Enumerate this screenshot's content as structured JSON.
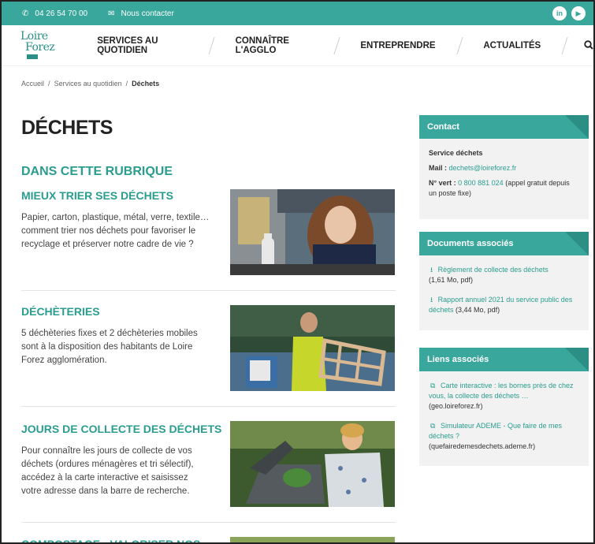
{
  "topbar": {
    "phone": "04 26 54 70 00",
    "contact": "Nous contacter",
    "phone_icon": "phone-icon",
    "contact_icon": "mail-icon",
    "social": [
      "linkedin-icon",
      "youtube-icon"
    ],
    "social_labels": [
      "in",
      "▶"
    ]
  },
  "nav": {
    "logo_line1": "Loire",
    "logo_line2": "Forez",
    "items": [
      "SERVICES AU QUOTIDIEN",
      "CONNAÎTRE L'AGGLO",
      "ENTREPRENDRE",
      "ACTUALITÉS"
    ],
    "search_icon": "🔍"
  },
  "breadcrumb": {
    "home": "Accueil",
    "sep": "/",
    "parent": "Services au quotidien",
    "current": "Déchets"
  },
  "page": {
    "title": "DÉCHETS",
    "rubrique": "DANS CETTE RUBRIQUE"
  },
  "entries": [
    {
      "title": "MIEUX TRIER SES DÉCHETS",
      "desc": "Papier, carton, plastique, métal, verre, textile… comment trier nos déchets pour favoriser le recyclage et préserver notre cadre de vie ?"
    },
    {
      "title": "DÉCHÈTERIES",
      "desc": "5 déchèteries fixes et 2 déchèteries mobiles sont à la disposition des habitants de Loire Forez agglomération."
    },
    {
      "title": "JOURS DE COLLECTE DES DÉCHETS",
      "desc": "Pour connaître les jours de collecte de vos déchets (ordures ménagères et tri sélectif), accédez à la carte interactive et saisissez votre adresse dans la barre de recherche."
    },
    {
      "title": "COMPOSTAGE : VALORISER NOS",
      "desc": ""
    }
  ],
  "sidebar": {
    "contact": {
      "title": "Contact",
      "service": "Service déchets",
      "mail_label": "Mail :",
      "mail": "dechets@loireforez.fr",
      "vert_label": "N° vert :",
      "vert": "0 800 881 024",
      "vert_note": "(appel gratuit depuis un poste fixe)"
    },
    "documents": {
      "title": "Documents associés",
      "items": [
        {
          "label": "Règlement de collecte des déchets",
          "meta": "(1,61 Mo, pdf)"
        },
        {
          "label": "Rapport annuel 2021 du service public des déchets",
          "meta": "(3,44 Mo, pdf)"
        }
      ]
    },
    "links": {
      "title": "Liens associés",
      "items": [
        {
          "label": "Carte interactive : les bornes près de chez vous, la collecte des déchets …",
          "meta": "(geo.loireforez.fr)"
        },
        {
          "label": "Simulateur ADEME - Que faire de mes déchets ?",
          "meta": "(quefairedemesdechets.ademe.fr)"
        }
      ]
    }
  },
  "colors": {
    "accent": "#3aa79c",
    "heading": "#2a9d8f"
  }
}
